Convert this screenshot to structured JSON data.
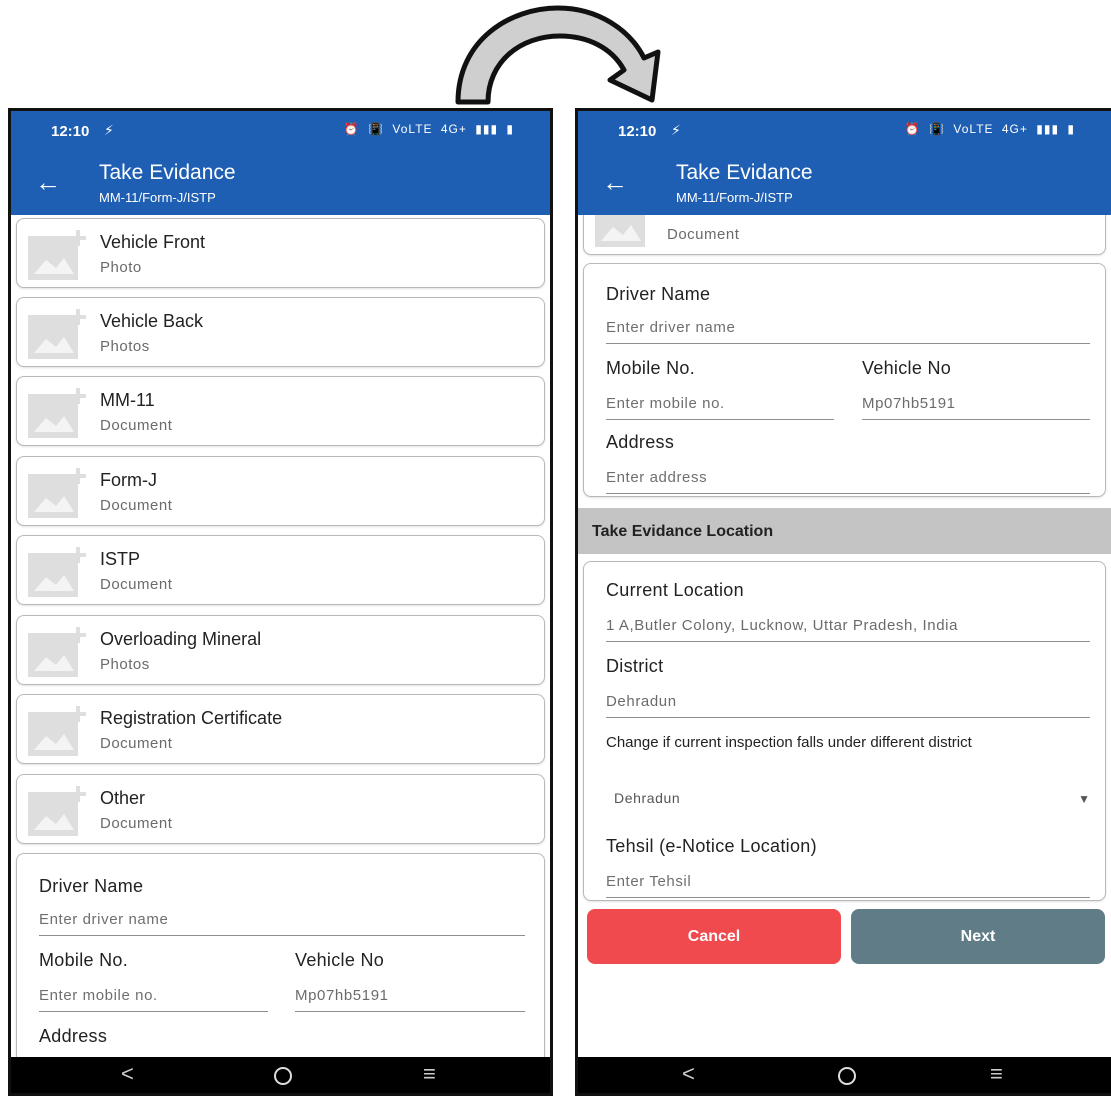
{
  "status_bar": {
    "time": "12:10",
    "charge_glyph": "⚡",
    "icons": [
      "⏰",
      "📳",
      "VoLTE",
      "4G+",
      "▮▮▮",
      "▮"
    ]
  },
  "app_bar": {
    "title": "Take Evidance",
    "subtitle": "MM-11/Form-J/ISTP"
  },
  "evidence_items": [
    {
      "title": "Vehicle Front",
      "subtitle": "Photo"
    },
    {
      "title": "Vehicle Back",
      "subtitle": "Photos"
    },
    {
      "title": "MM-11",
      "subtitle": "Document"
    },
    {
      "title": "Form-J",
      "subtitle": "Document"
    },
    {
      "title": "ISTP",
      "subtitle": "Document"
    },
    {
      "title": "Overloading Mineral",
      "subtitle": "Photos"
    },
    {
      "title": "Registration Certificate",
      "subtitle": "Document"
    },
    {
      "title": "Other",
      "subtitle": "Document"
    }
  ],
  "driver_form": {
    "driver_name_label": "Driver Name",
    "driver_name_placeholder": "Enter driver name",
    "mobile_label": "Mobile No.",
    "mobile_placeholder": "Enter mobile no.",
    "vehicle_label": "Vehicle No",
    "vehicle_value": "Mp07hb5191",
    "address_label": "Address",
    "address_placeholder": "Enter address"
  },
  "location_section": {
    "title": "Take Evidance Location",
    "current_location_label": "Current Location",
    "current_location_value": "1 A,Butler Colony, Lucknow, Uttar Pradesh, India",
    "district_label": "District",
    "district_value": "Dehradun",
    "change_hint": "Change if current inspection falls under different district",
    "district_select_value": "Dehradun",
    "tehsil_label": "Tehsil (e-Notice Location)",
    "tehsil_placeholder": "Enter Tehsil"
  },
  "buttons": {
    "cancel": "Cancel",
    "next": "Next"
  },
  "nav": {
    "back": "<",
    "home": "",
    "recents": "≡"
  },
  "colors": {
    "app_bar": "#1e5fb3",
    "cancel": "#f04a4e",
    "next": "#5f7c87",
    "section_band": "#c4c4c4"
  }
}
